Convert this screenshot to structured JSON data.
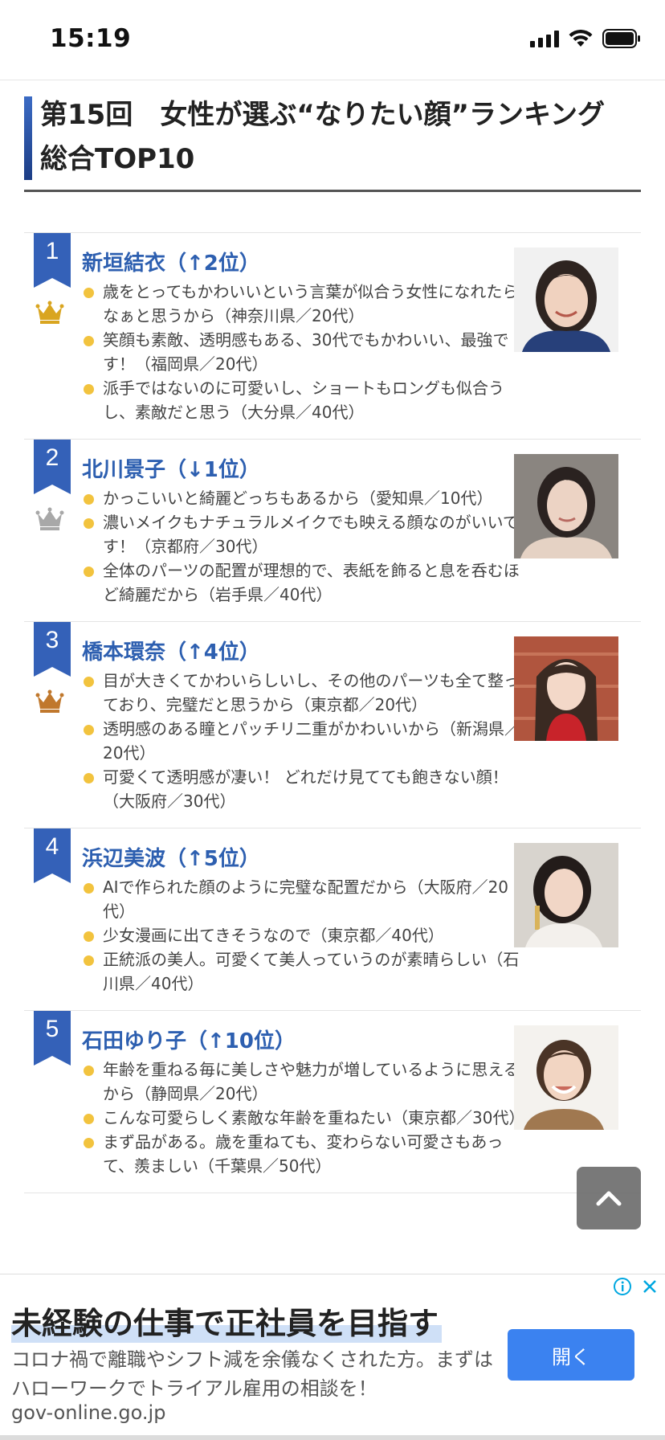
{
  "status_bar": {
    "time": "15:19",
    "icons": [
      "signal-icon",
      "wifi-icon",
      "battery-icon"
    ]
  },
  "heading": {
    "text": "第15回　女性が選ぶ“なりたい顔”ランキング　総合TOP10"
  },
  "colors": {
    "accent": "#2d5fb0",
    "badge": "#3461b8",
    "bullet": "#f2c33e",
    "gold": "#d9a520",
    "silver": "#a8a8a8",
    "bronze": "#c0782d"
  },
  "ranking": [
    {
      "rank": "1",
      "crown": "gold",
      "name": "新垣結衣（↑2位）",
      "reasons": [
        "歳をとってもかわいいという言葉が似合う女性になれたらなぁと思うから（神奈川県／20代）",
        "笑顔も素敵、透明感もある、30代でもかわいい、最強です！（福岡県／20代）",
        "派手ではないのに可愛いし、ショートもロングも似合うし、素敵だと思う（大分県／40代）"
      ]
    },
    {
      "rank": "2",
      "crown": "silver",
      "name": "北川景子（↓1位）",
      "reasons": [
        "かっこいいと綺麗どっちもあるから（愛知県／10代）",
        "濃いメイクもナチュラルメイクでも映える顔なのがいいです！（京都府／30代）",
        "全体のパーツの配置が理想的で、表紙を飾ると息を呑むほど綺麗だから（岩手県／40代）"
      ]
    },
    {
      "rank": "3",
      "crown": "bronze",
      "name": "橋本環奈（↑4位）",
      "reasons": [
        "目が大きくてかわいらしいし、その他のパーツも全て整っており、完璧だと思うから（東京都／20代）",
        "透明感のある瞳とパッチリ二重がかわいいから（新潟県／20代）",
        "可愛くて透明感が凄い！ どれだけ見てても飽きない顔！（大阪府／30代）"
      ]
    },
    {
      "rank": "4",
      "crown": "",
      "name": "浜辺美波（↑5位）",
      "reasons": [
        "AIで作られた顔のように完璧な配置だから（大阪府／20代）",
        "少女漫画に出てきそうなので（東京都／40代）",
        "正統派の美人。可愛くて美人っていうのが素晴らしい（石川県／40代）"
      ]
    },
    {
      "rank": "5",
      "crown": "",
      "name": "石田ゆり子（↑10位）",
      "reasons": [
        "年齢を重ねる毎に美しさや魅力が増しているように思えるから（静岡県／20代）",
        "こんな可愛らしく素敵な年齢を重ねたい（東京都／30代）",
        "まず品がある。歳を重ねても、変わらない可愛さもあって、羨ましい（千葉県／50代）"
      ]
    }
  ],
  "ad": {
    "title": "未経験の仕事で正社員を目指す",
    "description": "コロナ禍で離職やシフト減を余儀なくされた方。まずはハローワークでトライアル雇用の相談を！",
    "domain": "gov-online.go.jp",
    "button": "開く"
  }
}
